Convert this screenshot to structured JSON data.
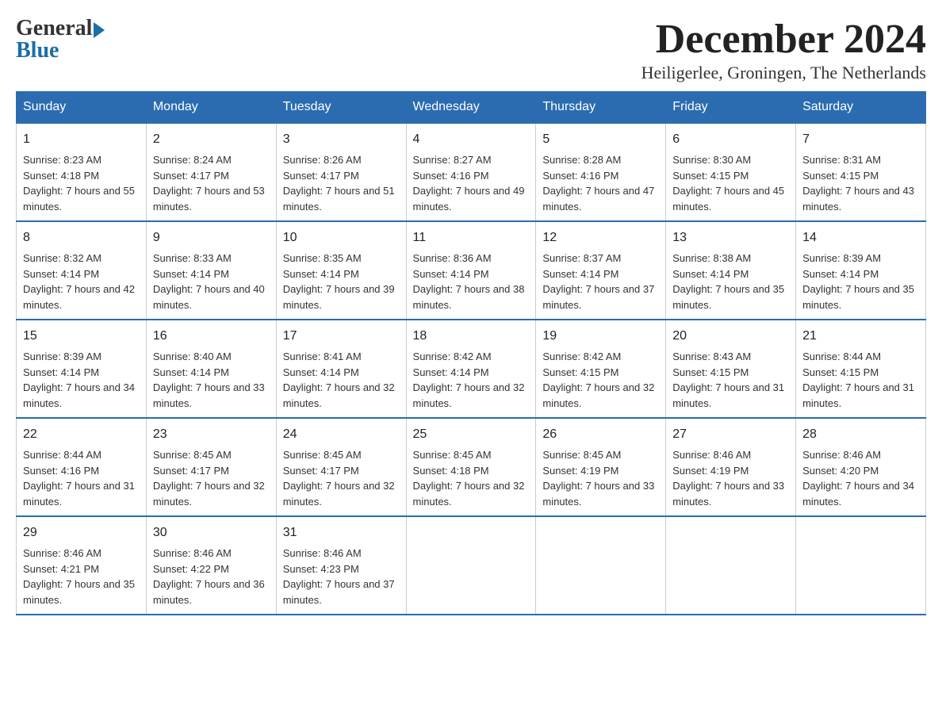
{
  "header": {
    "logo": {
      "general": "General",
      "blue": "Blue"
    },
    "title": "December 2024",
    "location": "Heiligerlee, Groningen, The Netherlands"
  },
  "weekdays": [
    "Sunday",
    "Monday",
    "Tuesday",
    "Wednesday",
    "Thursday",
    "Friday",
    "Saturday"
  ],
  "weeks": [
    [
      {
        "day": "1",
        "sunrise": "8:23 AM",
        "sunset": "4:18 PM",
        "daylight": "7 hours and 55 minutes."
      },
      {
        "day": "2",
        "sunrise": "8:24 AM",
        "sunset": "4:17 PM",
        "daylight": "7 hours and 53 minutes."
      },
      {
        "day": "3",
        "sunrise": "8:26 AM",
        "sunset": "4:17 PM",
        "daylight": "7 hours and 51 minutes."
      },
      {
        "day": "4",
        "sunrise": "8:27 AM",
        "sunset": "4:16 PM",
        "daylight": "7 hours and 49 minutes."
      },
      {
        "day": "5",
        "sunrise": "8:28 AM",
        "sunset": "4:16 PM",
        "daylight": "7 hours and 47 minutes."
      },
      {
        "day": "6",
        "sunrise": "8:30 AM",
        "sunset": "4:15 PM",
        "daylight": "7 hours and 45 minutes."
      },
      {
        "day": "7",
        "sunrise": "8:31 AM",
        "sunset": "4:15 PM",
        "daylight": "7 hours and 43 minutes."
      }
    ],
    [
      {
        "day": "8",
        "sunrise": "8:32 AM",
        "sunset": "4:14 PM",
        "daylight": "7 hours and 42 minutes."
      },
      {
        "day": "9",
        "sunrise": "8:33 AM",
        "sunset": "4:14 PM",
        "daylight": "7 hours and 40 minutes."
      },
      {
        "day": "10",
        "sunrise": "8:35 AM",
        "sunset": "4:14 PM",
        "daylight": "7 hours and 39 minutes."
      },
      {
        "day": "11",
        "sunrise": "8:36 AM",
        "sunset": "4:14 PM",
        "daylight": "7 hours and 38 minutes."
      },
      {
        "day": "12",
        "sunrise": "8:37 AM",
        "sunset": "4:14 PM",
        "daylight": "7 hours and 37 minutes."
      },
      {
        "day": "13",
        "sunrise": "8:38 AM",
        "sunset": "4:14 PM",
        "daylight": "7 hours and 35 minutes."
      },
      {
        "day": "14",
        "sunrise": "8:39 AM",
        "sunset": "4:14 PM",
        "daylight": "7 hours and 35 minutes."
      }
    ],
    [
      {
        "day": "15",
        "sunrise": "8:39 AM",
        "sunset": "4:14 PM",
        "daylight": "7 hours and 34 minutes."
      },
      {
        "day": "16",
        "sunrise": "8:40 AM",
        "sunset": "4:14 PM",
        "daylight": "7 hours and 33 minutes."
      },
      {
        "day": "17",
        "sunrise": "8:41 AM",
        "sunset": "4:14 PM",
        "daylight": "7 hours and 32 minutes."
      },
      {
        "day": "18",
        "sunrise": "8:42 AM",
        "sunset": "4:14 PM",
        "daylight": "7 hours and 32 minutes."
      },
      {
        "day": "19",
        "sunrise": "8:42 AM",
        "sunset": "4:15 PM",
        "daylight": "7 hours and 32 minutes."
      },
      {
        "day": "20",
        "sunrise": "8:43 AM",
        "sunset": "4:15 PM",
        "daylight": "7 hours and 31 minutes."
      },
      {
        "day": "21",
        "sunrise": "8:44 AM",
        "sunset": "4:15 PM",
        "daylight": "7 hours and 31 minutes."
      }
    ],
    [
      {
        "day": "22",
        "sunrise": "8:44 AM",
        "sunset": "4:16 PM",
        "daylight": "7 hours and 31 minutes."
      },
      {
        "day": "23",
        "sunrise": "8:45 AM",
        "sunset": "4:17 PM",
        "daylight": "7 hours and 32 minutes."
      },
      {
        "day": "24",
        "sunrise": "8:45 AM",
        "sunset": "4:17 PM",
        "daylight": "7 hours and 32 minutes."
      },
      {
        "day": "25",
        "sunrise": "8:45 AM",
        "sunset": "4:18 PM",
        "daylight": "7 hours and 32 minutes."
      },
      {
        "day": "26",
        "sunrise": "8:45 AM",
        "sunset": "4:19 PM",
        "daylight": "7 hours and 33 minutes."
      },
      {
        "day": "27",
        "sunrise": "8:46 AM",
        "sunset": "4:19 PM",
        "daylight": "7 hours and 33 minutes."
      },
      {
        "day": "28",
        "sunrise": "8:46 AM",
        "sunset": "4:20 PM",
        "daylight": "7 hours and 34 minutes."
      }
    ],
    [
      {
        "day": "29",
        "sunrise": "8:46 AM",
        "sunset": "4:21 PM",
        "daylight": "7 hours and 35 minutes."
      },
      {
        "day": "30",
        "sunrise": "8:46 AM",
        "sunset": "4:22 PM",
        "daylight": "7 hours and 36 minutes."
      },
      {
        "day": "31",
        "sunrise": "8:46 AM",
        "sunset": "4:23 PM",
        "daylight": "7 hours and 37 minutes."
      },
      null,
      null,
      null,
      null
    ]
  ]
}
